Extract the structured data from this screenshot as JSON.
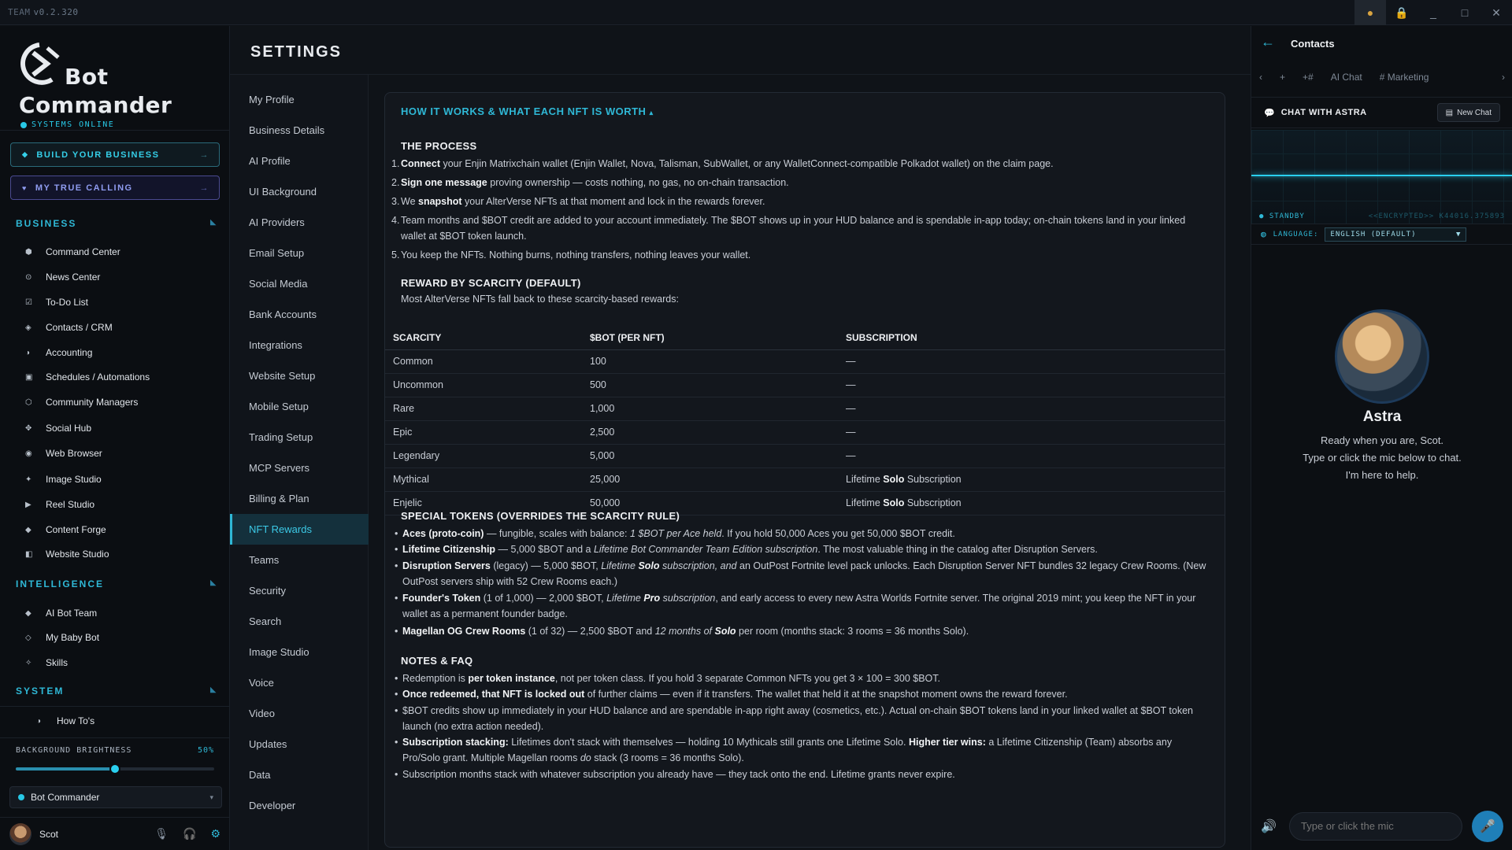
{
  "titlebar": {
    "app": "TEAM",
    "version": "v0.2.320"
  },
  "brand": {
    "line1": "Bot",
    "line2": "Commander",
    "status": "SYSTEMS ONLINE"
  },
  "cta": {
    "build": "BUILD YOUR BUSINESS",
    "calling": "MY TRUE CALLING",
    "arrow": "→"
  },
  "sections": {
    "business": "BUSINESS",
    "intelligence": "INTELLIGENCE",
    "system": "SYSTEM"
  },
  "business_items": [
    "Command Center",
    "News Center",
    "To-Do List",
    "Contacts / CRM",
    "Accounting",
    "Schedules / Automations",
    "Community Managers",
    "Social Hub",
    "Web Browser",
    "Image Studio",
    "Reel Studio",
    "Content Forge",
    "Website Studio"
  ],
  "intelligence_items": [
    "AI Bot Team",
    "My Baby Bot",
    "Skills"
  ],
  "system_items": [
    "How To's"
  ],
  "brightness": {
    "label": "BACKGROUND BRIGHTNESS",
    "value_text": "50%",
    "value": 0.5
  },
  "workspace": {
    "name": "Bot Commander"
  },
  "user": {
    "name": "Scot"
  },
  "settings": {
    "title": "SETTINGS"
  },
  "subnav": [
    "My Profile",
    "Business Details",
    "AI Profile",
    "UI Background",
    "AI Providers",
    "Email Setup",
    "Social Media",
    "Bank Accounts",
    "Integrations",
    "Website Setup",
    "Mobile Setup",
    "Trading Setup",
    "MCP Servers",
    "Billing & Plan",
    "NFT Rewards",
    "Teams",
    "Security",
    "Search",
    "Image Studio",
    "Voice",
    "Video",
    "Updates",
    "Data",
    "Developer"
  ],
  "subnav_active": "NFT Rewards",
  "card": {
    "title": "HOW IT WORKS & WHAT EACH NFT IS WORTH",
    "process_h": "THE PROCESS",
    "process": [
      {
        "n": "1.",
        "b": "Connect",
        "t": " your Enjin Matrixchain wallet (Enjin Wallet, Nova, Talisman, SubWallet, or any WalletConnect-compatible Polkadot wallet) on the claim page."
      },
      {
        "n": "2.",
        "b": "Sign one message",
        "t": " proving ownership — costs nothing, no gas, no on-chain transaction."
      },
      {
        "n": "3.",
        "pre": "We ",
        "b": "snapshot",
        "t": " your AlterVerse NFTs at that moment and lock in the rewards forever."
      },
      {
        "n": "4.",
        "b": "",
        "t": "Team months and $BOT credit are added to your account immediately. The $BOT shows up in your HUD balance and is spendable in-app today; on-chain tokens land in your linked wallet at $BOT token launch."
      },
      {
        "n": "5.",
        "b": "",
        "t": "You keep the NFTs. Nothing burns, nothing transfers, nothing leaves your wallet."
      }
    ],
    "reward_h": "REWARD BY SCARCITY (DEFAULT)",
    "reward_p": "Most AlterVerse NFTs fall back to these scarcity-based rewards:",
    "table_head": [
      "SCARCITY",
      "$BOT (PER NFT)",
      "SUBSCRIPTION"
    ],
    "table_rows": [
      [
        "Common",
        "100",
        "—"
      ],
      [
        "Uncommon",
        "500",
        "—"
      ],
      [
        "Rare",
        "1,000",
        "—"
      ],
      [
        "Epic",
        "2,500",
        "—"
      ],
      [
        "Legendary",
        "5,000",
        "—"
      ],
      [
        "Mythical",
        "25,000",
        "Lifetime Solo Subscription"
      ],
      [
        "Enjelic",
        "50,000",
        "Lifetime Solo Subscription"
      ]
    ],
    "special_h": "SPECIAL TOKENS (OVERRIDES THE SCARCITY RULE)",
    "notes_h": "NOTES & FAQ"
  },
  "chat": {
    "title": "Contacts",
    "tabs": [
      "+",
      "+#",
      "AI Chat",
      "# Marketing"
    ],
    "chat_with": "CHAT WITH ASTRA",
    "new_chat": "New Chat",
    "standby": "STANDBY",
    "encrypted": "<<ENCRYPTED>> K44016.375893",
    "language_label": "LANGUAGE:",
    "language_value": "ENGLISH (DEFAULT)",
    "bot_name": "Astra",
    "greeting": [
      "Ready when you are, Scot.",
      "Type or click the mic below to chat.",
      "I'm here to help."
    ],
    "placeholder": "Type or click the mic"
  }
}
